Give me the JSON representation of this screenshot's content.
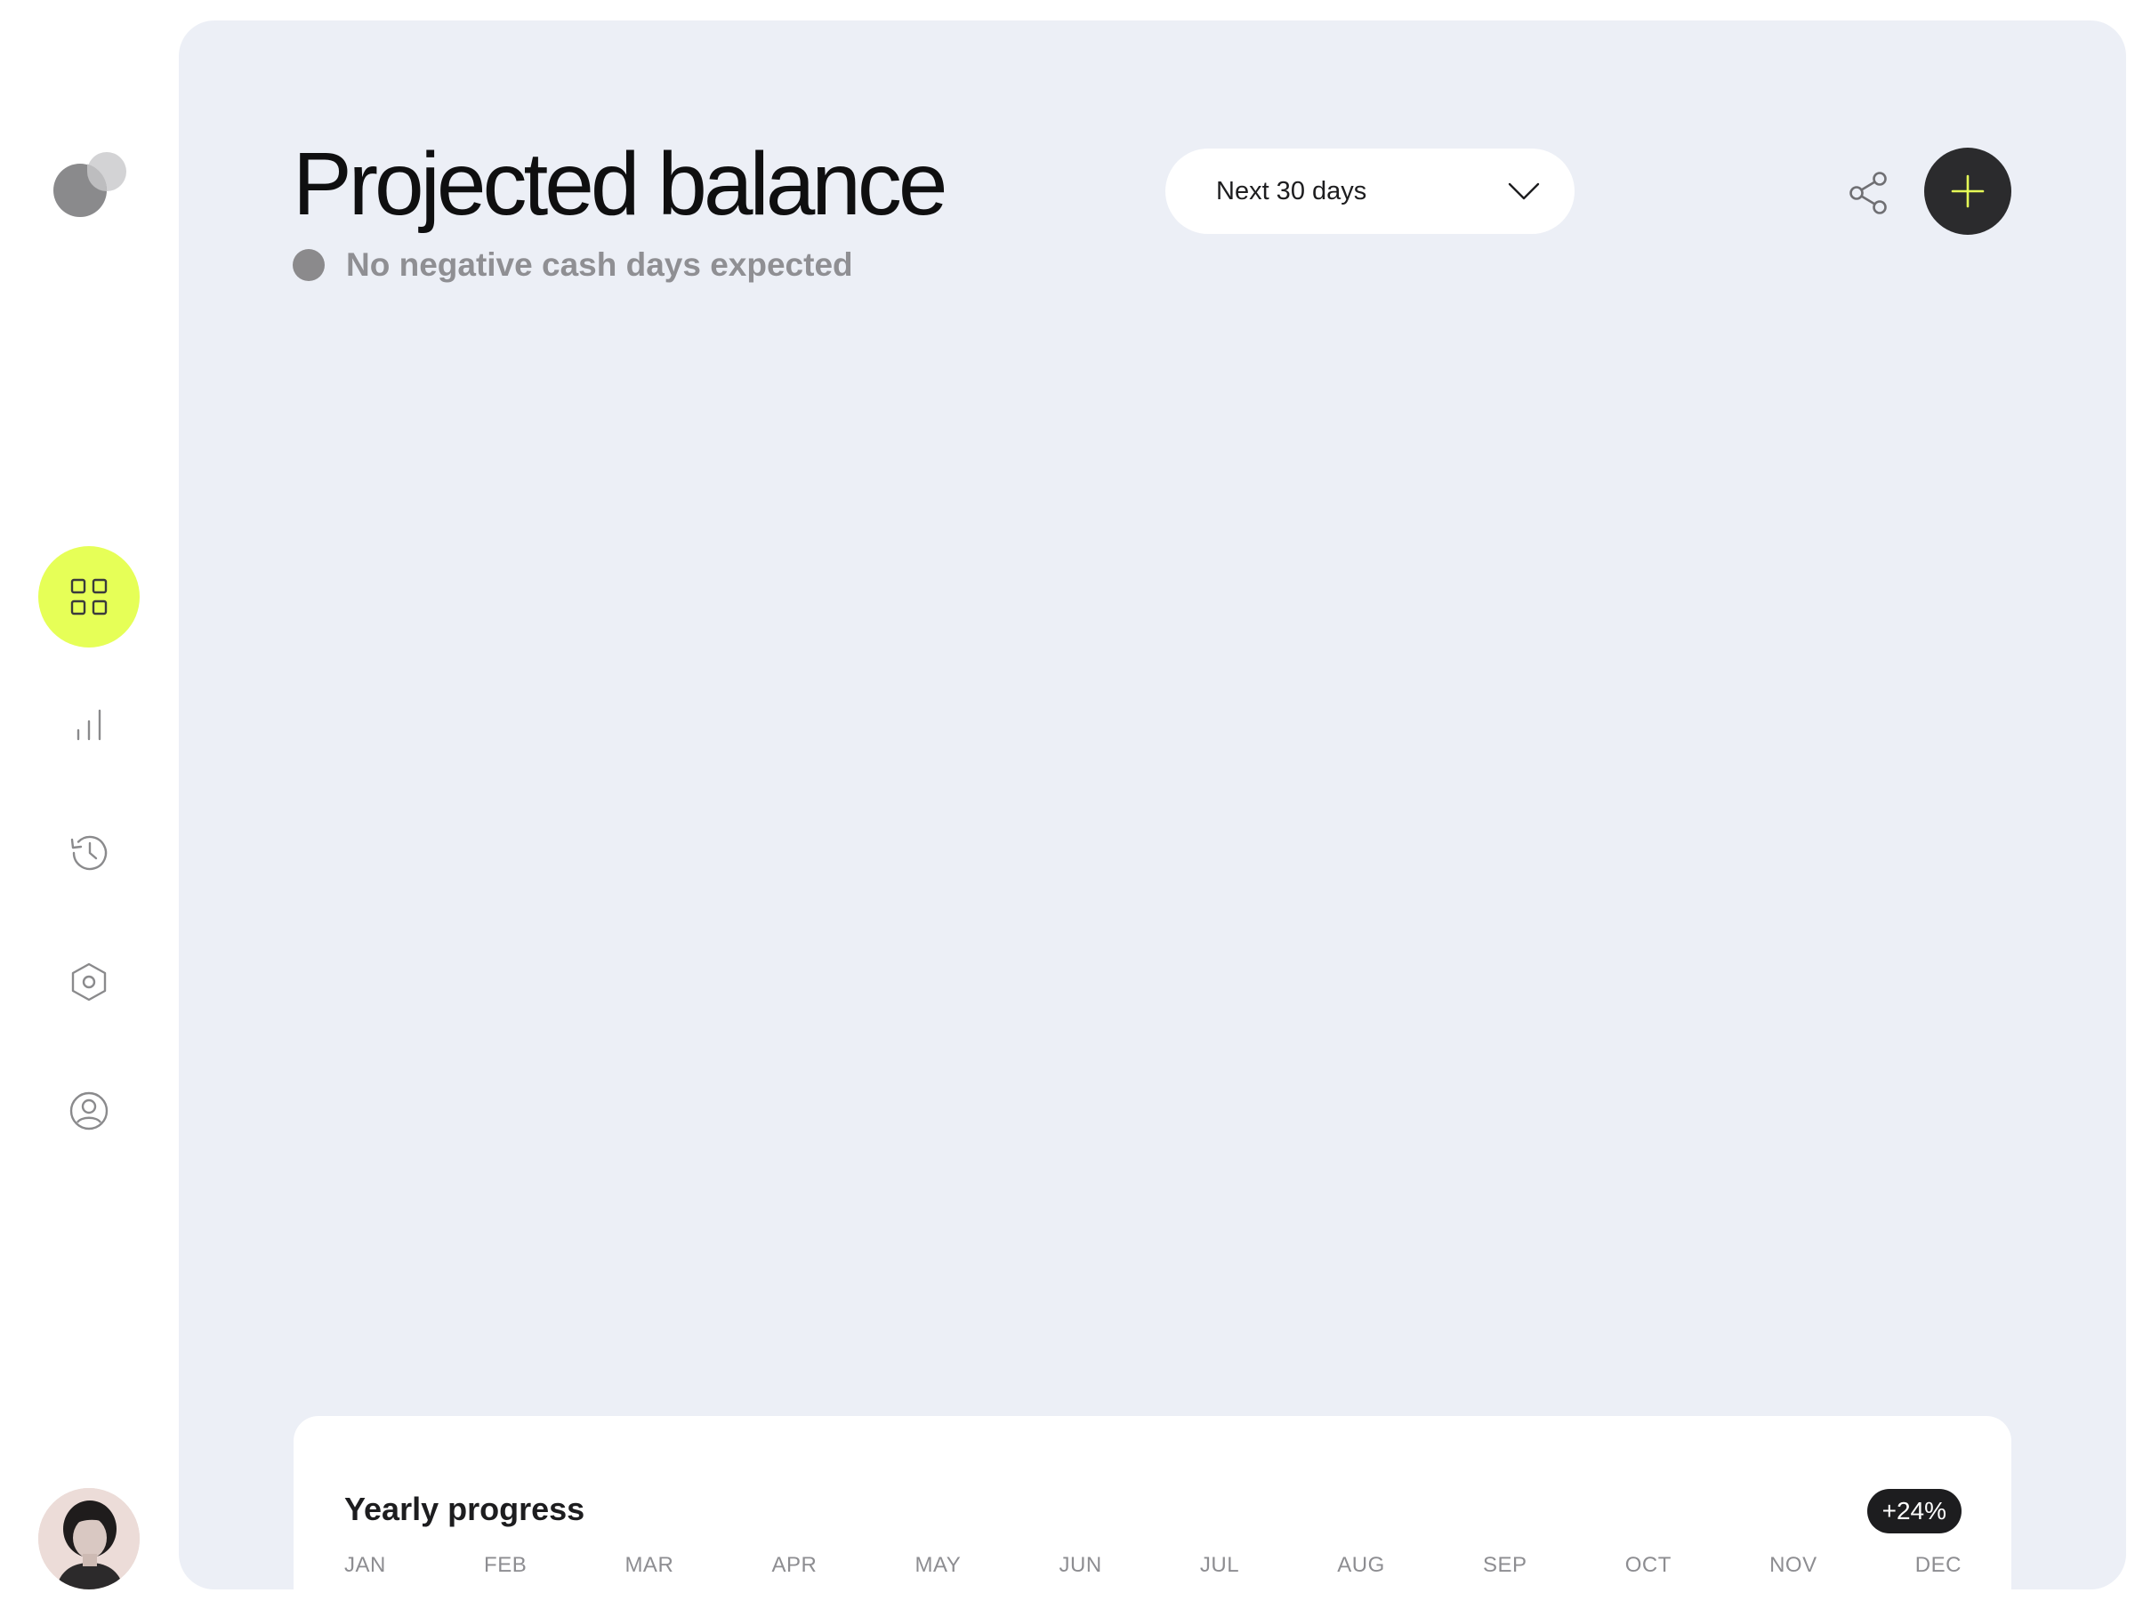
{
  "sidebar": {
    "nav": [
      {
        "icon": "dashboard-grid-icon",
        "active": true
      },
      {
        "icon": "bar-chart-icon",
        "active": false
      },
      {
        "icon": "history-icon",
        "active": false
      },
      {
        "icon": "settings-hexagon-icon",
        "active": false
      },
      {
        "icon": "user-circle-icon",
        "active": false
      }
    ],
    "accent": "#e6ff57"
  },
  "header": {
    "title": "Projected balance",
    "status_text": "No negative cash days expected",
    "range": {
      "selected": "Next 30 days"
    }
  },
  "progress": {
    "title": "Yearly progress",
    "badge": "+24%",
    "months": [
      "JAN",
      "FEB",
      "MAR",
      "APR",
      "MAY",
      "JUN",
      "JUL",
      "AUG",
      "SEP",
      "OCT",
      "NOV",
      "DEC"
    ]
  },
  "colors": {
    "panel_bg": "#eceff6",
    "dark": "#2b2b2d",
    "plus": "#e6ff57"
  }
}
